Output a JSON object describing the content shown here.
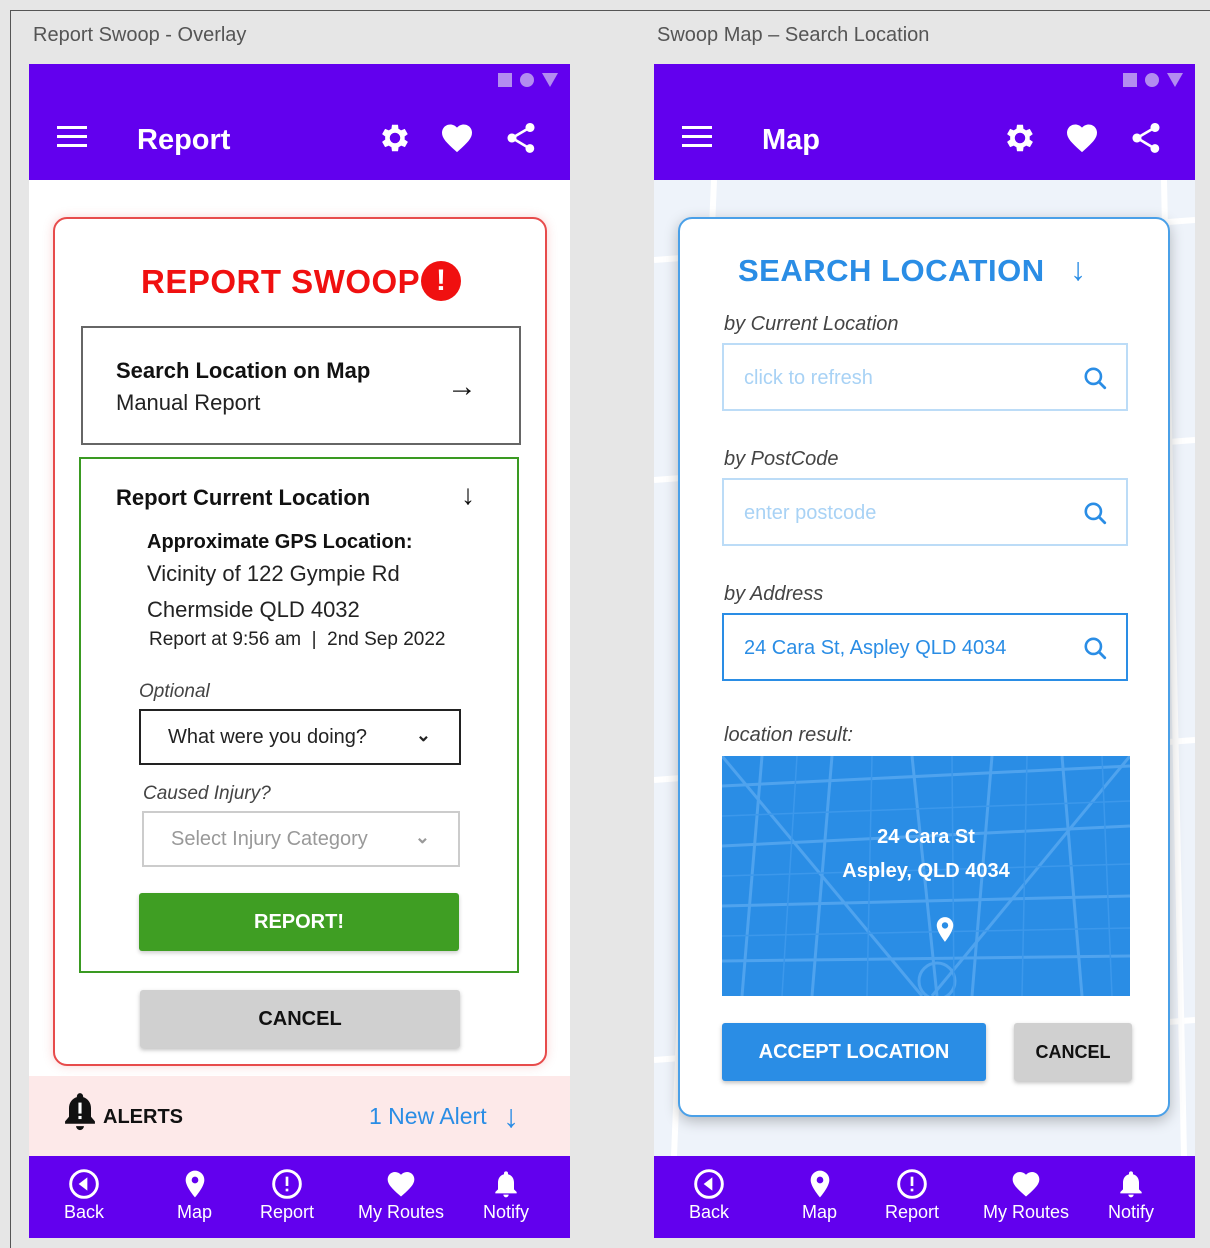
{
  "screens": {
    "left_label": "Report Swoop - Overlay",
    "right_label": "Swoop Map – Search Location"
  },
  "left_phone": {
    "appbar_title": "Report",
    "report_title": "REPORT SWOOP",
    "alert_glyph": "!",
    "search_option": {
      "title": "Search Location on Map",
      "subtitle": "Manual Report",
      "arrow": "→"
    },
    "current_location": {
      "header": "Report Current Location",
      "arrow": "↓",
      "gps_label": "Approximate GPS Location:",
      "address_line1": "Vicinity of 122 Gympie Rd",
      "address_line2": "Chermside QLD 4032",
      "report_time": "Report at 9:56 am  |  2nd Sep 2022",
      "optional_label": "Optional",
      "activity_select": "What were you doing?",
      "injury_label": "Caused Injury?",
      "injury_select": "Select Injury Category",
      "report_button": "REPORT!"
    },
    "cancel_button": "CANCEL",
    "alerts": {
      "label": "ALERTS",
      "new_alert": "1 New Alert",
      "arrow": "↓"
    }
  },
  "right_phone": {
    "appbar_title": "Map",
    "search_title": "SEARCH LOCATION",
    "search_arrow": "↓",
    "current_label": "by Current Location",
    "current_placeholder": "click to refresh",
    "postcode_label": "by PostCode",
    "postcode_placeholder": "enter postcode",
    "address_label": "by Address",
    "address_value": "24 Cara St, Aspley QLD 4034",
    "result_label": "location result:",
    "result_line1": "24 Cara St",
    "result_line2": "Aspley, QLD 4034",
    "accept_button": "ACCEPT LOCATION",
    "cancel_button": "CANCEL"
  },
  "nav": {
    "back": "Back",
    "map": "Map",
    "report": "Report",
    "routes": "My Routes",
    "notify": "Notify"
  },
  "icons": {
    "menu": "hamburger-icon",
    "settings": "gear-icon",
    "favorite": "heart-icon",
    "share": "share-icon",
    "search": "search-icon",
    "pin": "map-pin-icon",
    "bell": "bell-icon"
  },
  "colors": {
    "brand": "#6200ee",
    "danger": "#f01010",
    "success": "#3f9e23",
    "info": "#2a8de5",
    "alert_bg": "#fde9e9"
  }
}
